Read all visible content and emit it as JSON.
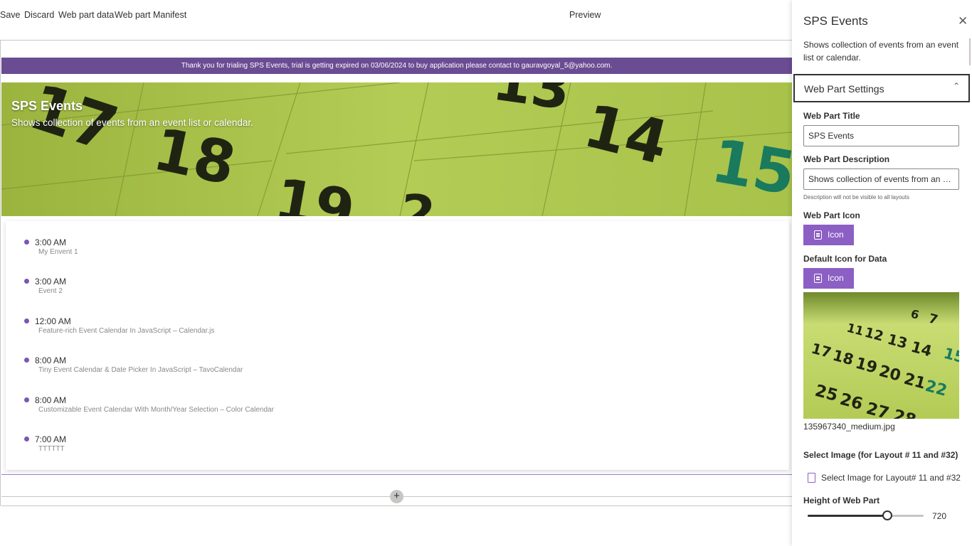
{
  "toolbar": {
    "save": "Save",
    "discard": "Discard",
    "web_part_data": "Web part data",
    "web_part_manifest": "Web part Manifest",
    "preview": "Preview"
  },
  "trial_banner": "Thank you for trialing SPS Events, trial is getting expired on 03/06/2024 to buy application please contact to gauravgoyal_5@yahoo.com.",
  "webpart": {
    "title": "SPS Events",
    "description": "Shows collection of events from an event list or calendar."
  },
  "events": [
    {
      "time": "3:00 AM",
      "name": "My Envent 1"
    },
    {
      "time": "3:00 AM",
      "name": "Event 2"
    },
    {
      "time": "12:00 AM",
      "name": "Feature-rich Event Calendar In JavaScript – Calendar.js"
    },
    {
      "time": "8:00 AM",
      "name": "Tiny Event Calendar & Date Picker In JavaScript – TavoCalendar"
    },
    {
      "time": "8:00 AM",
      "name": "Customizable Event Calendar With Month/Year Selection – Color Calendar"
    },
    {
      "time": "7:00 AM",
      "name": "TTTTTT"
    }
  ],
  "add_section_symbol": "+",
  "pane": {
    "title": "SPS Events",
    "close_symbol": "✕",
    "description": "Shows collection of events from an event list or calendar.",
    "group_header": "Web Part Settings",
    "group_chevron": "⌃",
    "title_label": "Web Part Title",
    "title_value": "SPS Events",
    "desc_label": "Web Part Description",
    "desc_value": "Shows collection of events from an event list or calendar.",
    "desc_hint": "Description will not be visible to all layouts",
    "icon_label": "Web Part Icon",
    "icon_button": "Icon",
    "default_icon_label": "Default Icon for Data",
    "default_icon_button": "Icon",
    "image_filename": "135967340_medium.jpg",
    "select_image_label": "Select Image (for Layout # 11 and #32)",
    "select_image_link": "Select Image for Layout# 11 and #32",
    "height_label": "Height of Web Part",
    "height_value": "720",
    "height_fraction": 0.69
  },
  "colors": {
    "accent": "#8c5fc4",
    "banner": "#6a4c93",
    "hero_green": "#a5c043"
  },
  "icons": [
    "close-icon",
    "chevron-up-icon",
    "calendar-icon",
    "document-image-icon",
    "plus-icon"
  ]
}
